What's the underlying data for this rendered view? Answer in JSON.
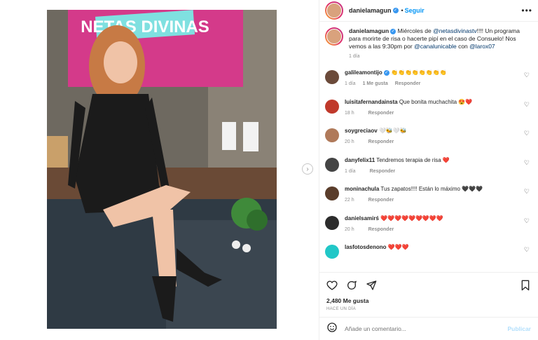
{
  "post": {
    "author": "danielamagun",
    "follow_label": "Seguir",
    "more_label": "•••",
    "caption": {
      "username": "danielamagun",
      "text_1": " Miércoles de ",
      "mention_1": "@netasdivinastv",
      "text_2": "!!!! Un programa para morirte de risa o hacerte pipí en el caso de Consuelo! Nos vemos a las 9:30pm por ",
      "mention_2": "@canalunicable",
      "text_3": " con ",
      "mention_3": "@larox07",
      "time": "1 día"
    },
    "set_backdrop": "NETAS DIVINAS"
  },
  "comments": [
    {
      "user": "galileamontijo",
      "verified": true,
      "text": "👏👏👏👏👏👏👏👏",
      "time": "1 día",
      "likes": "1 Me gusta",
      "reply": "Responder",
      "avatar_color": "#6b4a3a"
    },
    {
      "user": "luisitafernandainsta",
      "verified": false,
      "text": "Que bonita muchachita 😍❤️",
      "time": "18 h",
      "likes": "",
      "reply": "Responder",
      "avatar_color": "#c0392b"
    },
    {
      "user": "soygreciaov",
      "verified": false,
      "text": "🤍🐝🤍🐝",
      "time": "20 h",
      "likes": "",
      "reply": "Responder",
      "avatar_color": "#b07a5a"
    },
    {
      "user": "danyfelix11",
      "verified": false,
      "text": "Tendremos terapia de risa ❤️",
      "time": "1 día",
      "likes": "",
      "reply": "Responder",
      "avatar_color": "#444444"
    },
    {
      "user": "moninachula",
      "verified": false,
      "text": "Tus zapatos!!!! Están lo máximo 🖤🖤🖤",
      "time": "22 h",
      "likes": "",
      "reply": "Responder",
      "avatar_color": "#5a3d2b"
    },
    {
      "user": "danielsamirś",
      "verified": false,
      "text": "❤️❤️❤️❤️❤️❤️❤️❤️❤️",
      "time": "20 h",
      "likes": "",
      "reply": "Responder",
      "avatar_color": "#2c2c2c"
    },
    {
      "user": "lasfotosdenono",
      "verified": false,
      "text": "❤️❤️❤️",
      "time": "",
      "likes": "",
      "reply": "",
      "avatar_color": "#21c7c7"
    }
  ],
  "footer": {
    "likes": "2,480 Me gusta",
    "date": "HACE UN DÍA",
    "comment_placeholder": "Añade un comentario...",
    "publish_label": "Publicar"
  },
  "icons": {
    "like": "heart-icon",
    "comment": "comment-icon",
    "share": "share-icon",
    "save": "bookmark-icon",
    "emoji": "emoji-icon"
  },
  "colors": {
    "accent": "#0095f6",
    "verified": "#3897f0",
    "border": "#efefef",
    "muted": "#8e8e8e"
  }
}
